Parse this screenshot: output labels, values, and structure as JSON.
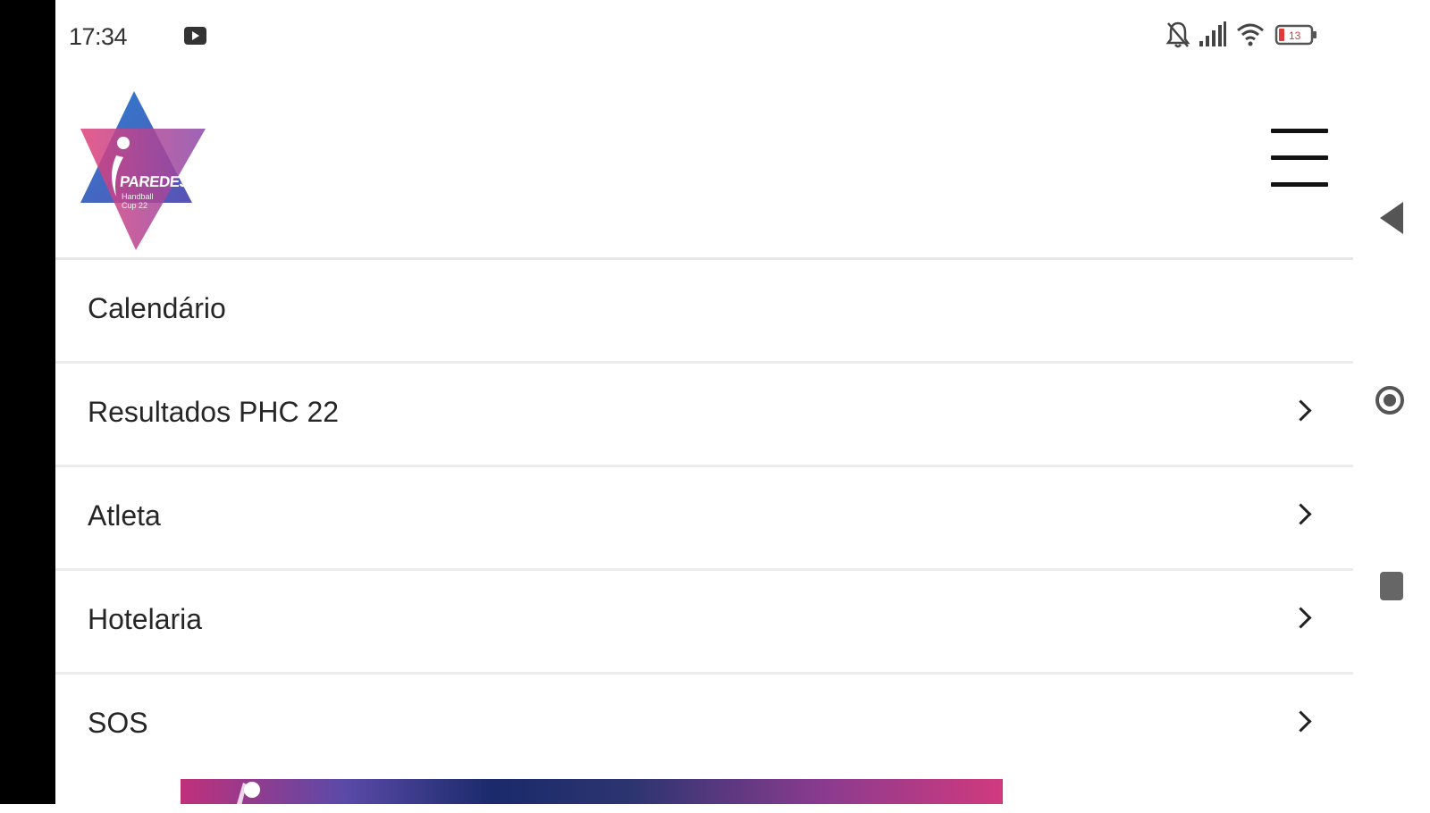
{
  "status_bar": {
    "time": "17:34",
    "icons": [
      "media-notification-icon",
      "bell-off-icon",
      "signal-icon",
      "wifi-icon",
      "battery-icon"
    ],
    "battery_level": "13"
  },
  "header": {
    "logo": {
      "name": "PAREDES",
      "subtitle_line1": "Handball",
      "subtitle_line2": "Cup 22"
    },
    "menu_icon": "hamburger-menu-icon"
  },
  "menu": {
    "items": [
      {
        "label": "Calendário",
        "has_chevron": false
      },
      {
        "label": "Resultados PHC 22",
        "has_chevron": true
      },
      {
        "label": "Atleta",
        "has_chevron": true
      },
      {
        "label": "Hotelaria",
        "has_chevron": true
      },
      {
        "label": "SOS",
        "has_chevron": true
      }
    ]
  },
  "colors": {
    "brand_pink": "#d63a7a",
    "brand_blue": "#2a74c4",
    "brand_purple": "#6a4ca8",
    "text": "#262626",
    "divider": "#ececec"
  },
  "nav_bar": {
    "icons": [
      "back-icon",
      "home-icon",
      "recents-icon"
    ]
  }
}
